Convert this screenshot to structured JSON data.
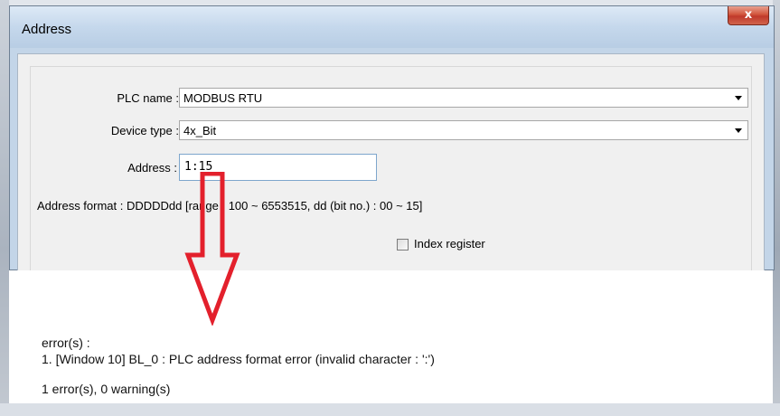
{
  "window": {
    "title": "Address",
    "close_glyph": "x"
  },
  "form": {
    "plc_name_label": "PLC name :",
    "plc_name_value": "MODBUS RTU",
    "device_type_label": "Device type :",
    "device_type_value": "4x_Bit",
    "address_label": "Address :",
    "address_value": "1:15",
    "address_format_text": "Address format : DDDDDdd [range : 100 ~ 6553515, dd (bit no.) : 00 ~ 15]",
    "index_register_label": "Index register",
    "index_register_checked": false
  },
  "messages": {
    "header": "error(s) :",
    "error_line": "1. [Window 10] BL_0  : PLC address format error (invalid character : ':')",
    "summary": "1 error(s), 0 warning(s)"
  },
  "annotation": {
    "arrow_color": "#e3202c",
    "icon": "down-arrow-icon"
  }
}
